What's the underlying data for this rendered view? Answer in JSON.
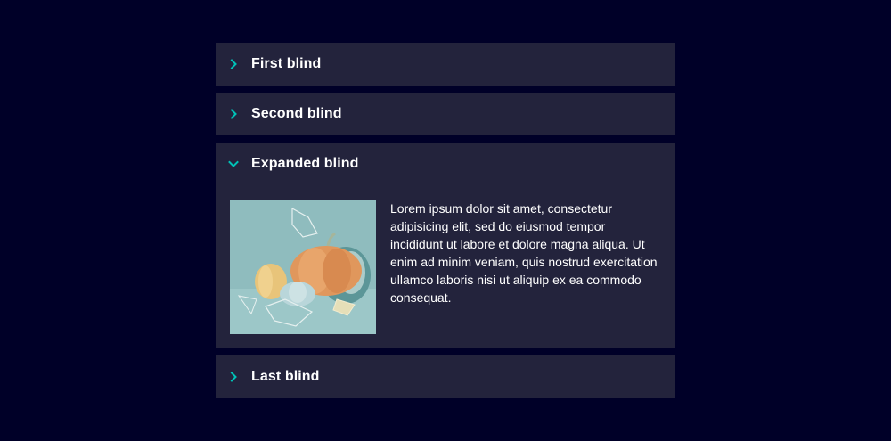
{
  "colors": {
    "page_background": "#000028",
    "blind_background": "#23233c",
    "chevron_accent": "#00c1b6",
    "text": "#ffffff"
  },
  "accordion": {
    "blinds": [
      {
        "title": "First blind",
        "expanded": false,
        "icon": "chevron-right-icon"
      },
      {
        "title": "Second blind",
        "expanded": false,
        "icon": "chevron-right-icon"
      },
      {
        "title": "Expanded blind",
        "expanded": true,
        "icon": "chevron-down-icon",
        "content": {
          "image": "pumpkin-still-life-image",
          "text": "Lorem ipsum dolor sit amet, consectetur adipisicing elit, sed do eiusmod tempor incididunt ut labore et dolore magna aliqua. Ut enim ad minim veniam, quis nostrud exercitation ullamco laboris nisi ut aliquip ex ea commodo consequat."
        }
      },
      {
        "title": "Last blind",
        "expanded": false,
        "icon": "chevron-right-icon"
      }
    ]
  }
}
